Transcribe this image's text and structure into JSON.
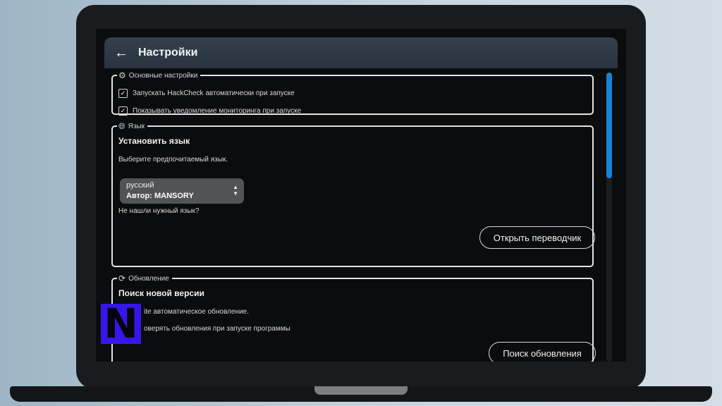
{
  "header": {
    "back_icon": "arrow-left-icon",
    "title": "Настройки"
  },
  "sections": {
    "basic": {
      "icon": "gear-icon",
      "legend": "Основные настройки",
      "options": [
        {
          "label": "Запускать HackCheck автоматически при запуске",
          "checked": true
        },
        {
          "label": "Показывать уведомление мониторинга при запуске",
          "checked": true
        }
      ]
    },
    "language": {
      "icon": "globe-icon",
      "legend": "Язык",
      "heading": "Установить язык",
      "prompt": "Выберите предпочитаемый язык.",
      "select": {
        "language": "русский",
        "author": "Автор: MANSORY"
      },
      "missing_text": "Не нашли нужный язык?",
      "translator_button": "Открыть переводчик"
    },
    "update": {
      "icon": "refresh-icon",
      "legend": "Обновление",
      "heading": "Поиск новой версии",
      "line1": "ite автоматическое обновление.",
      "line2": "оверять обновления при запуске программы",
      "search_button": "Поиск обновления"
    }
  },
  "overlay_logo": "N",
  "colors": {
    "accent": "#1683d4",
    "logo": "#3617ea",
    "header": "#2f3b47",
    "panel_border": "#e3e3e3",
    "select_bg": "#525357"
  }
}
